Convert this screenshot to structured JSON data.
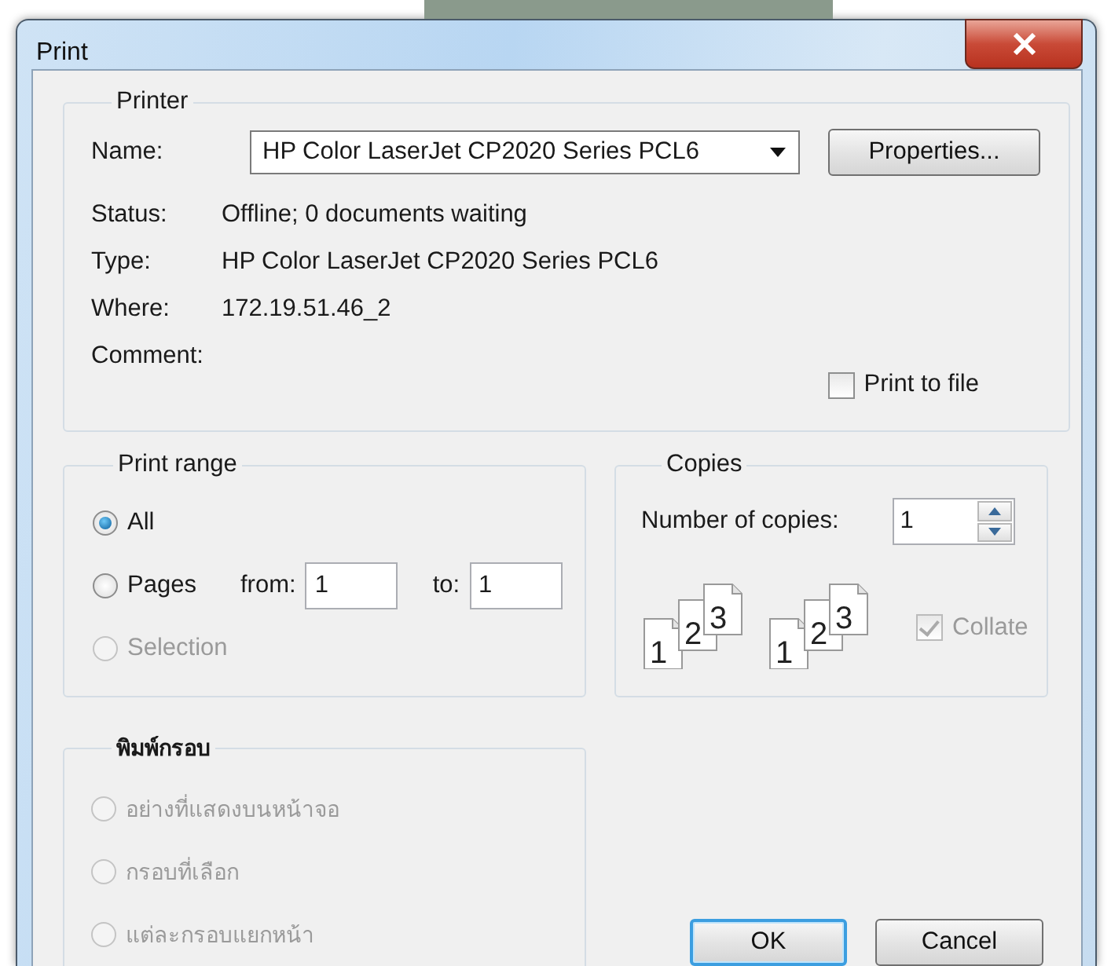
{
  "window": {
    "title": "Print"
  },
  "printer": {
    "title": "Printer",
    "name_label": "Name:",
    "name_value": "HP Color LaserJet CP2020 Series PCL6",
    "properties_button": "Properties...",
    "info": [
      {
        "label": "Status:",
        "value": "Offline; 0 documents waiting"
      },
      {
        "label": "Type:",
        "value": "HP Color LaserJet CP2020 Series PCL6"
      },
      {
        "label": "Where:",
        "value": "172.19.51.46_2"
      },
      {
        "label": "Comment:"
      }
    ],
    "print_to_file": {
      "label": "Print to file",
      "checked": false
    }
  },
  "print_range": {
    "title": "Print range",
    "options": [
      {
        "label": "All",
        "selected": true,
        "disabled": false
      },
      {
        "label": "Pages",
        "selected": false,
        "disabled": false
      },
      {
        "label": "Selection",
        "selected": false,
        "disabled": true
      }
    ],
    "from_label": "from:",
    "from_value": "1",
    "to_label": "to:",
    "to_value": "1"
  },
  "copies": {
    "title": "Copies",
    "number_label": "Number of copies:",
    "number_value": "1",
    "collate_icons": [
      {
        "pages": [
          "1",
          "2",
          "3"
        ]
      },
      {
        "pages": [
          "1",
          "2",
          "3"
        ]
      }
    ],
    "collate": {
      "label": "Collate",
      "checked": true,
      "disabled": true
    }
  },
  "frames": {
    "title": "พิมพ์กรอบ",
    "options": [
      {
        "label": "อย่างที่แสดงบนหน้าจอ",
        "selected": false,
        "disabled": true
      },
      {
        "label": "กรอบที่เลือก",
        "selected": false,
        "disabled": true
      },
      {
        "label": "แต่ละกรอบแยกหน้า",
        "selected": false,
        "disabled": true
      }
    ]
  },
  "buttons": [
    {
      "label": "OK",
      "default": true
    },
    {
      "label": "Cancel",
      "default": false
    }
  ]
}
